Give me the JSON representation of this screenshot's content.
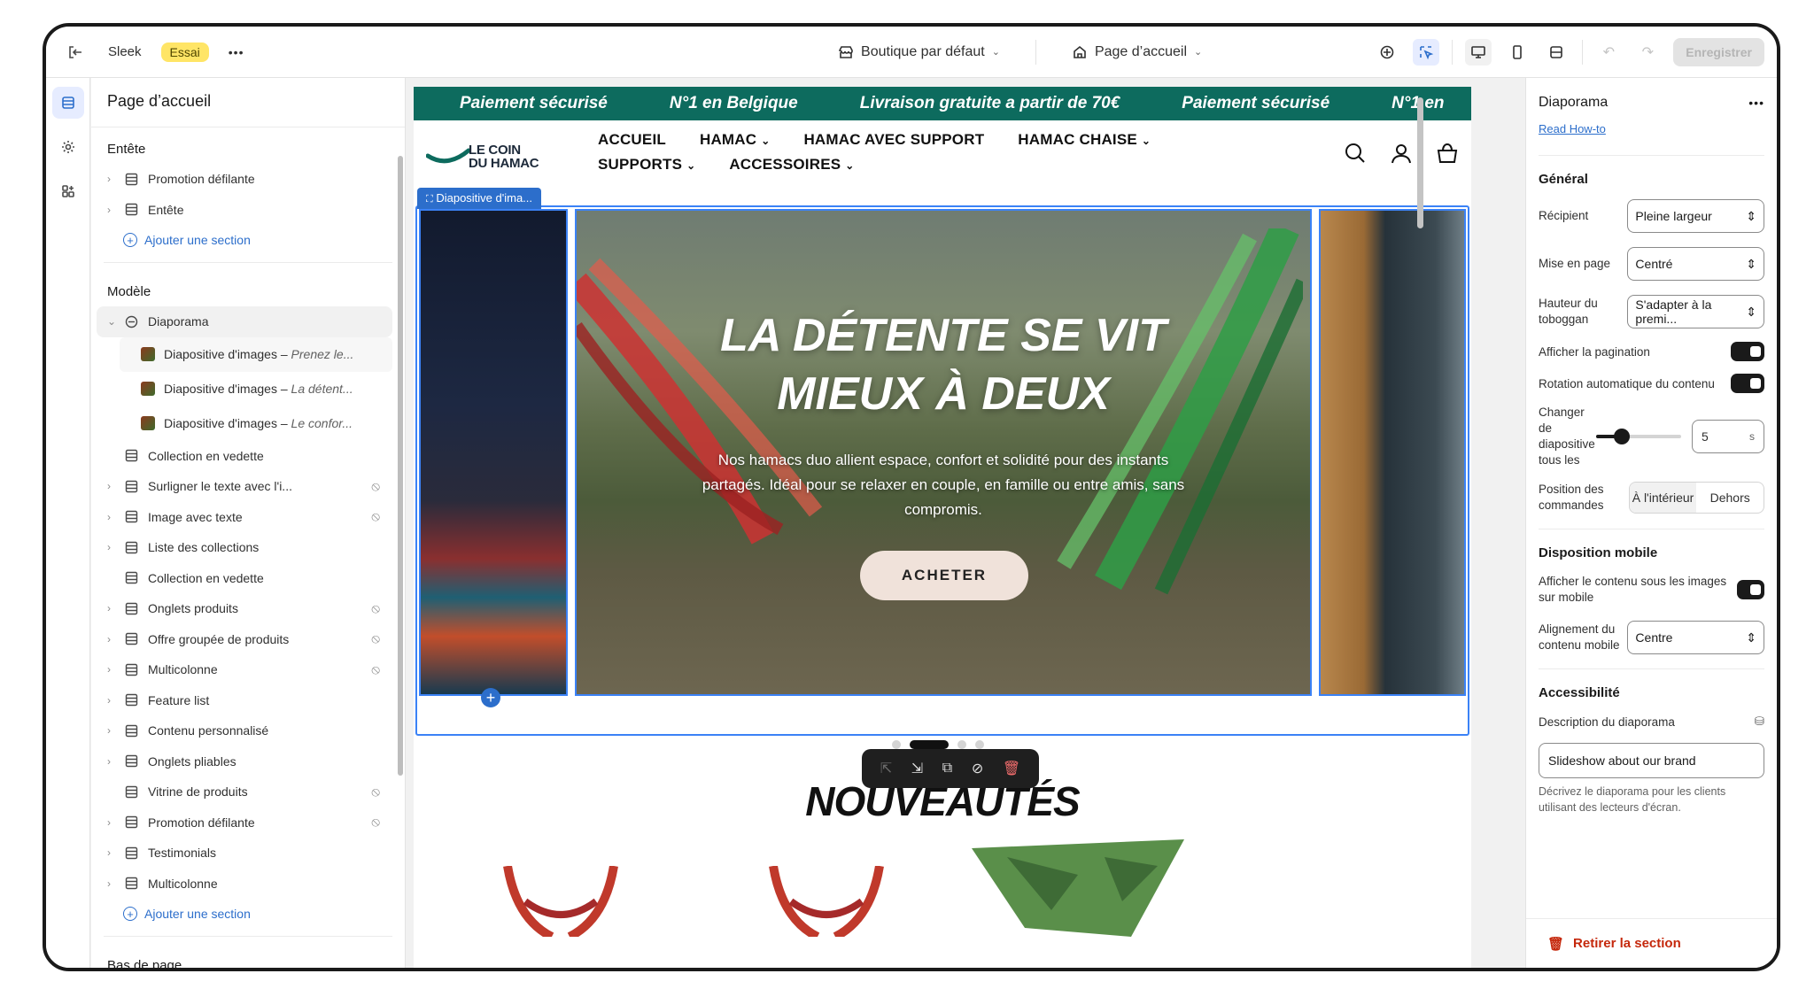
{
  "topbar": {
    "theme_name": "Sleek",
    "trial_badge": "Essai",
    "more": "•••",
    "store_select": "Boutique par défaut",
    "page_select": "Page d’accueil",
    "save_label": "Enregistrer"
  },
  "left_panel": {
    "title": "Page d’accueil",
    "header_group": "Entête",
    "header_items": [
      "Promotion défilante",
      "Entête"
    ],
    "add_section": "Ajouter une section",
    "template_group": "Modèle",
    "slideshow": "Diaporama",
    "slides": [
      {
        "name": "Diapositive d'images",
        "sub": "Prenez le..."
      },
      {
        "name": "Diapositive d'images",
        "sub": "La détent..."
      },
      {
        "name": "Diapositive d'images",
        "sub": "Le confor..."
      }
    ],
    "sections": [
      {
        "label": "Collection en vedette",
        "hidden": false,
        "chev": false
      },
      {
        "label": "Surligner le texte avec l'i...",
        "hidden": true,
        "chev": true
      },
      {
        "label": "Image avec texte",
        "hidden": true,
        "chev": true
      },
      {
        "label": "Liste des collections",
        "hidden": false,
        "chev": true
      },
      {
        "label": "Collection en vedette",
        "hidden": false,
        "chev": false
      },
      {
        "label": "Onglets produits",
        "hidden": true,
        "chev": true
      },
      {
        "label": "Offre groupée de produits",
        "hidden": true,
        "chev": true
      },
      {
        "label": "Multicolonne",
        "hidden": true,
        "chev": true
      },
      {
        "label": "Feature list",
        "hidden": false,
        "chev": true
      },
      {
        "label": "Contenu personnalisé",
        "hidden": false,
        "chev": true
      },
      {
        "label": "Onglets pliables",
        "hidden": false,
        "chev": true
      },
      {
        "label": "Vitrine de produits",
        "hidden": true,
        "chev": false
      },
      {
        "label": "Promotion défilante",
        "hidden": true,
        "chev": true
      },
      {
        "label": "Testimonials",
        "hidden": false,
        "chev": true
      },
      {
        "label": "Multicolonne",
        "hidden": false,
        "chev": true
      }
    ],
    "add_section_2": "Ajouter une section",
    "footer_group": "Bas de page"
  },
  "preview": {
    "marquee": [
      "Paiement sécurisé",
      "N°1 en Belgique",
      "Livraison gratuite a partir de 70€",
      "Paiement sécurisé",
      "N°1 en"
    ],
    "logo_line1": "LE COIN",
    "logo_line2": "DU HAMAC",
    "menu": [
      {
        "label": "ACCUEIL",
        "dropdown": false
      },
      {
        "label": "HAMAC",
        "dropdown": true
      },
      {
        "label": "HAMAC AVEC SUPPORT",
        "dropdown": false
      },
      {
        "label": "HAMAC CHAISE",
        "dropdown": true
      },
      {
        "label": "SUPPORTS",
        "dropdown": true
      },
      {
        "label": "ACCESSOIRES",
        "dropdown": true
      }
    ],
    "selected_label": "Diapositive d'ima...",
    "hero_title_1": "LA DÉTENTE SE VIT",
    "hero_title_2": "MIEUX À DEUX",
    "hero_text": "Nos hamacs duo allient espace, confort et solidité pour des instants partagés. Idéal pour se relaxer en couple, en famille ou entre amis, sans compromis.",
    "hero_button": "ACHETER",
    "section_title": "NOUVEAUTÉS",
    "colors": {
      "marquee_bg": "#0d6b5e",
      "selection": "#2c6ecb"
    }
  },
  "right_panel": {
    "title": "Diaporama",
    "howto": "Read How-to",
    "general": "Général",
    "container_label": "Récipient",
    "container_value": "Pleine largeur",
    "layout_label": "Mise en page",
    "layout_value": "Centré",
    "height_label": "Hauteur du toboggan",
    "height_value": "S'adapter à la premi...",
    "pagination_label": "Afficher la pagination",
    "autorotate_label": "Rotation automatique du contenu",
    "change_label": "Changer de diapositive tous les",
    "change_value": "5",
    "change_unit": "s",
    "change_fraction": 0.3,
    "controls_label": "Position des commandes",
    "controls_inside": "À l'intérieur",
    "controls_outside": "Dehors",
    "mobile_section": "Disposition mobile",
    "mobile_below_label": "Afficher le contenu sous les images sur mobile",
    "mobile_align_label": "Alignement du contenu mobile",
    "mobile_align_value": "Centre",
    "accessibility": "Accessibilité",
    "desc_label": "Description du diaporama",
    "desc_value": "Slideshow about our brand",
    "desc_help": "Décrivez le diaporama pour les clients utilisant des lecteurs d'écran.",
    "remove": "Retirer la section"
  }
}
